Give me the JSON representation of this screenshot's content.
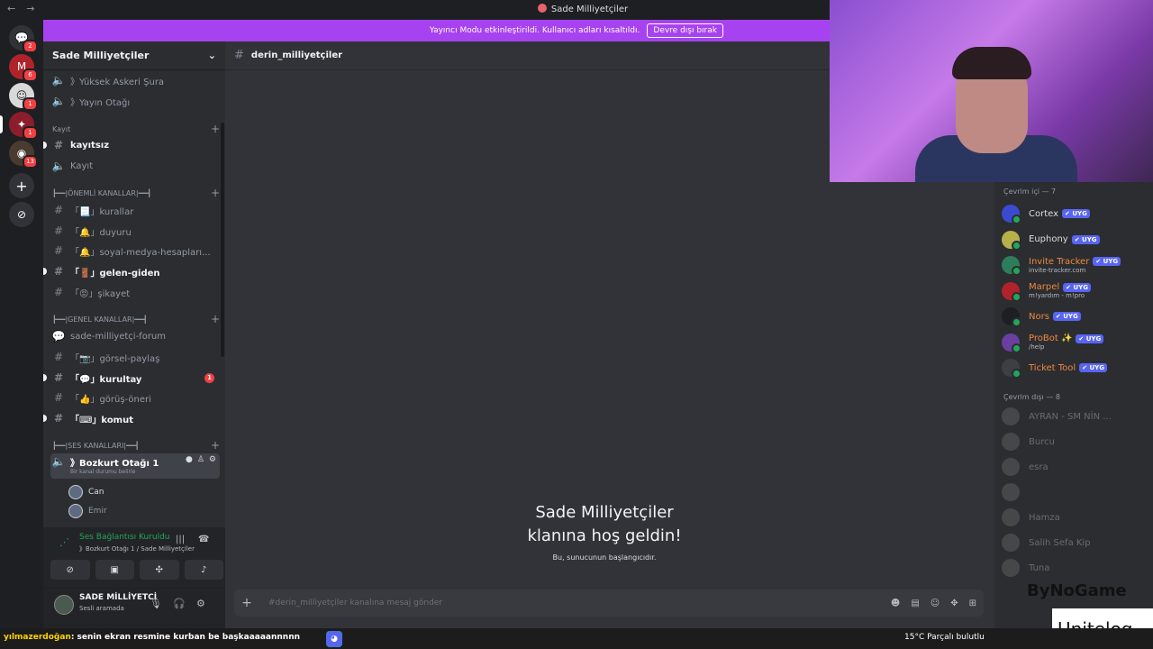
{
  "window": {
    "title": "Sade Milliyetçiler"
  },
  "banner": {
    "message": "Yayıncı Modu etkinleştirildi. Kullanıcı adları kısaltıldı.",
    "button": "Devre dışı bırak"
  },
  "guild_badges": [
    "2",
    "6",
    "1",
    "1",
    "13"
  ],
  "server": {
    "name": "Sade Milliyetçiler"
  },
  "channels": {
    "yuksek": "》Yüksek Askeri Şura",
    "yayin": "》Yayın Otağı",
    "cat_kayit": "Kayıt",
    "kayitsiz": "kayıtsız",
    "kayit": "Kayıt",
    "cat_onemli": "┣━━|ÖNEMLİ KANALLAR|━━┫",
    "kurallar": "「📃」kurallar",
    "duyuru": "「🔔」duyuru",
    "sosyal": "「🔔」soyal-medya-hesapları...",
    "gelen": "「🚪」gelen-giden",
    "sikayet": "「😡」şikayet",
    "cat_genel": "┣━━|GENEL KANALLAR|━━┫",
    "forum": "sade-milliyetçi-forum",
    "gorsel": "「📷」görsel-paylaş",
    "kurultay": "「💬」kurultay",
    "kurultay_mention": "1",
    "gorus": "「👍」görüş-öneri",
    "komut": "「⌨」komut",
    "cat_ses": "┣━━|SES KANALLARI|━━┫",
    "bozkurt": "》Bozkurt Otağı 1",
    "bozkurt_status": "Bir kanal durumu belirle",
    "voice_members": [
      "Can",
      "Emir"
    ]
  },
  "voice_panel": {
    "status": "Ses Bağlantısı Kuruldu",
    "location": "》Bozkurt Otağı 1 / Sade Milliyetçiler"
  },
  "user": {
    "name": "SADE MİLLİYETCİ",
    "status": "Sesli aramada"
  },
  "chat": {
    "channel": "derin_milliyetçiler",
    "welcome_line1": "Sade Milliyetçiler",
    "welcome_line2": "klanına hoş geldin!",
    "welcome_sub": "Bu, sunucunun başlangıcıdır.",
    "placeholder": "#derin_milliyetçiler kanalına mesaj gönder"
  },
  "members": {
    "online_header": "Çevrim içi — 7",
    "offline_header": "Çevrim dışı — 8",
    "online": [
      {
        "name": "Cortex",
        "tag": "✔ UYG",
        "sub": "",
        "color": "#dbdee1",
        "avatar": "#3b4bd1"
      },
      {
        "name": "Euphony",
        "tag": "✔ UYG",
        "sub": "",
        "color": "#dbdee1",
        "avatar": "#b7b04a"
      },
      {
        "name": "Invite Tracker",
        "tag": "✔ UYG",
        "sub": "invite-tracker.com",
        "color": "#f0883e",
        "avatar": "#2e7d5b"
      },
      {
        "name": "Marpel",
        "tag": "✔ UYG",
        "sub": "m!yardım - m!pro",
        "color": "#f0883e",
        "avatar": "#b0232b"
      },
      {
        "name": "Nors",
        "tag": "✔ UYG",
        "sub": "",
        "color": "#f0883e",
        "avatar": "#1e1f22"
      },
      {
        "name": "ProBot ✨",
        "tag": "✔ UYG",
        "sub": "/help",
        "color": "#f0883e",
        "avatar": "#6b3fa0"
      },
      {
        "name": "Ticket Tool",
        "tag": "✔ UYG",
        "sub": "",
        "color": "#f0883e",
        "avatar": "#3d3f45"
      }
    ],
    "offline": [
      "AYRAN - SM NİN ...",
      "Burcu",
      "esra",
      "",
      "Hamza",
      "Salih Sefa Kip",
      "Tuna"
    ]
  },
  "watermark": {
    "top": "ByNoGame",
    "bottom": "Unitelog"
  },
  "taskbar": {
    "ticker_name": "yılmazerdoğan",
    "ticker_text": ": senin ekran resmine kurban be başkaaaaannnnn",
    "weather": "15°C  Parçalı bulutlu"
  },
  "colors": {
    "accent": "#5865f2",
    "banner": "#a742f1",
    "online": "#23a55a",
    "mention": "#f23f43"
  }
}
